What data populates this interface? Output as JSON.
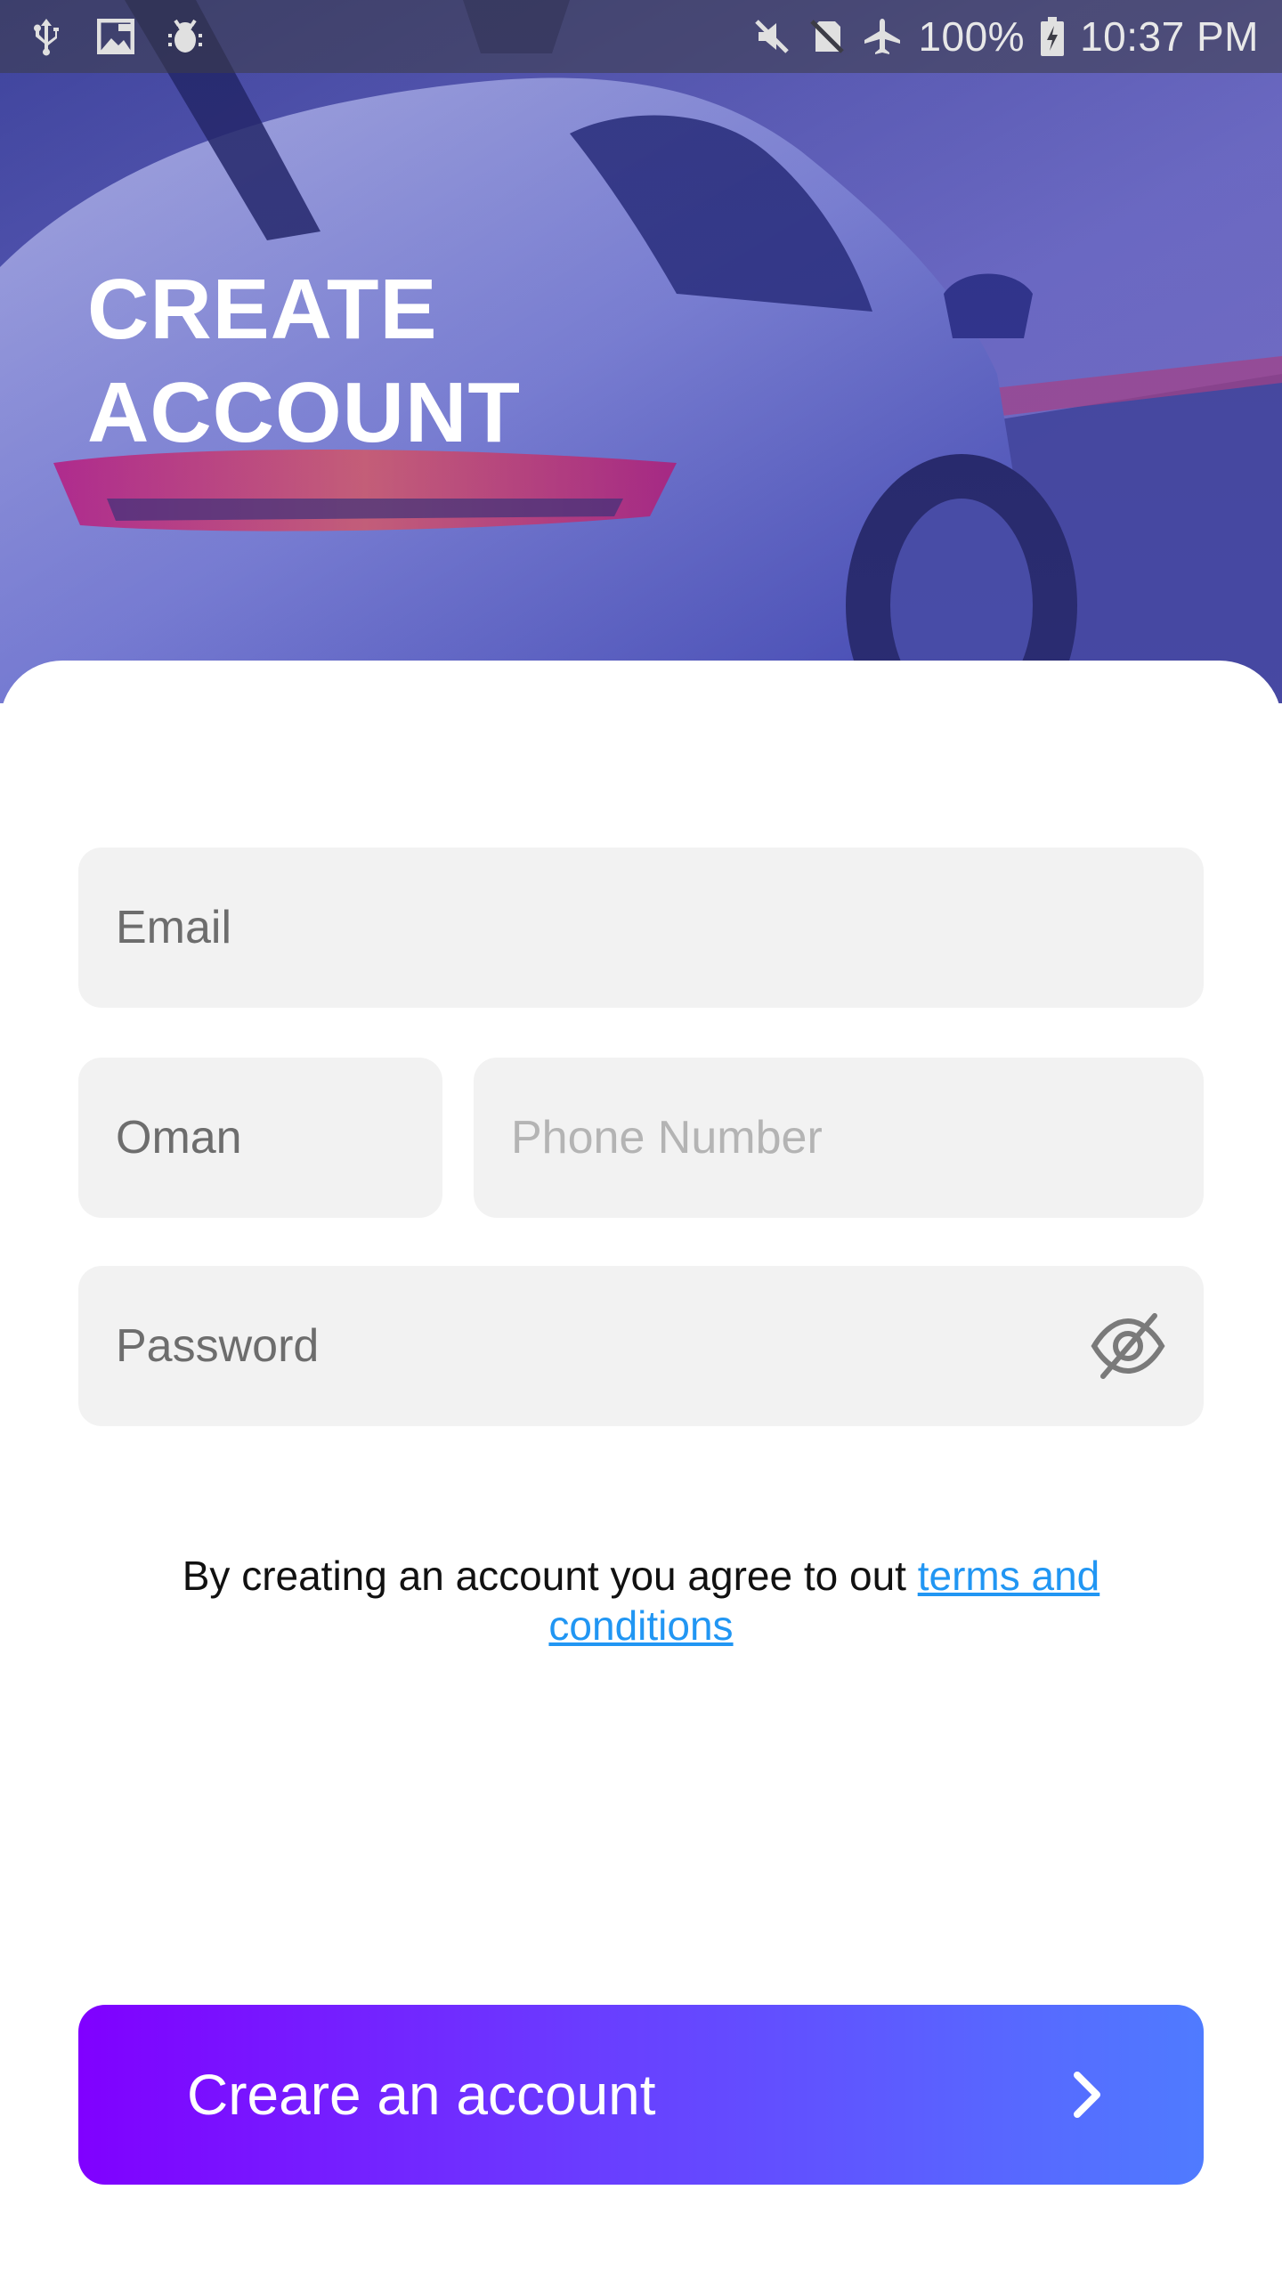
{
  "status_bar": {
    "left_icons": [
      "usb-icon",
      "image-icon",
      "bug-icon"
    ],
    "right_icons": [
      "mute-icon",
      "no-sim-icon",
      "airplane-icon"
    ],
    "battery_percent": "100%",
    "time": "10:37 PM"
  },
  "hero": {
    "title_line1": "CREATE",
    "title_line2": "ACCOUNT"
  },
  "form": {
    "email_placeholder": "Email",
    "country_value": "Oman",
    "phone_placeholder": "Phone Number",
    "password_placeholder": "Password",
    "password_toggle_icon": "eye-off-icon"
  },
  "terms": {
    "prefix": "By creating an account you agree to out ",
    "link_text": "terms and conditions"
  },
  "cta": {
    "label": "Creare an account",
    "icon": "chevron-right-icon"
  },
  "colors": {
    "button_gradient_start": "#8000ff",
    "button_gradient_end": "#4f7bff",
    "link": "#2196f3",
    "field_bg": "#f2f2f2"
  }
}
